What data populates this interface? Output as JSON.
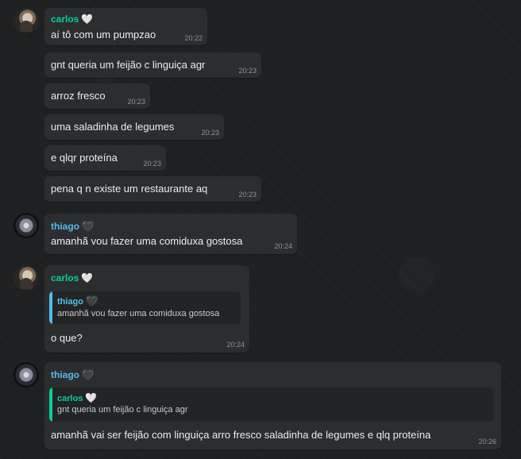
{
  "users": {
    "carlos": {
      "name": "carlos",
      "badge": "🤍"
    },
    "thiago": {
      "name": "thiago",
      "badge": "🖤"
    }
  },
  "messages": [
    {
      "text": "aí tô com um pumpzao",
      "time": "20:22"
    },
    {
      "text": "gnt queria um feijão c linguiça agr",
      "time": "20:23"
    },
    {
      "text": "arroz fresco",
      "time": "20:23"
    },
    {
      "text": "uma saladinha de legumes",
      "time": "20:23"
    },
    {
      "text": "e qlqr proteína",
      "time": "20:23"
    },
    {
      "text": "pena q n existe um restaurante aq",
      "time": "20:23"
    },
    {
      "text": "amanhã vou fazer uma comiduxa gostosa",
      "time": "20:24"
    },
    {
      "text": "o que?",
      "time": "20:24",
      "quote": {
        "name": "thiago",
        "badge": "🖤",
        "text": "amanhã vou fazer uma comiduxa gostosa"
      }
    },
    {
      "text": "amanhã vai ser feijão com linguiça arro fresco  saladinha de legumes e qlq proteína",
      "time": "20:26",
      "quote": {
        "name": "carlos",
        "badge": "🤍",
        "text": "gnt queria um feijão c linguiça agr"
      }
    }
  ]
}
